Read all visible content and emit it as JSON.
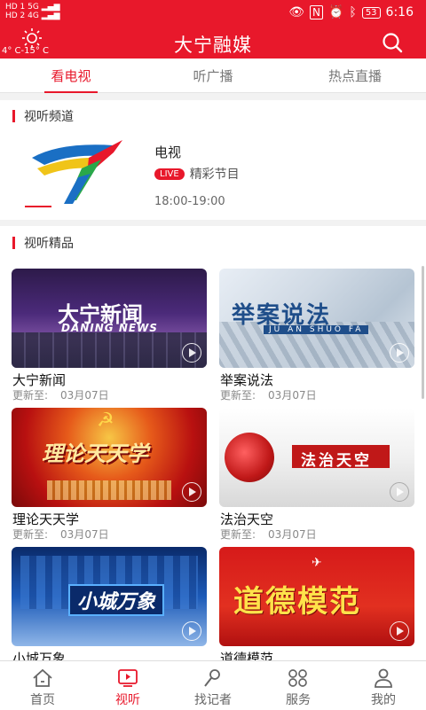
{
  "status_bar": {
    "sim1": "HD 1",
    "sim2": "HD 2",
    "network": "5G",
    "network2": "4G",
    "battery": "53",
    "time": "6:16"
  },
  "header": {
    "weather_temp": "4° C-15° C",
    "title": "大宁融媒",
    "weather_icon": "sun-icon",
    "search_icon": "search-icon"
  },
  "tabs": [
    {
      "label": "看电视"
    },
    {
      "label": "听广播"
    },
    {
      "label": "热点直播"
    }
  ],
  "channels_section": {
    "title": "视听频道"
  },
  "channel": {
    "name": "电视",
    "live_badge": "LIVE",
    "program": "精彩节目",
    "time": "18:00-19:00"
  },
  "premium_section": {
    "title": "视听精品"
  },
  "programs": [
    {
      "title": "大宁新闻",
      "update_label": "更新至:",
      "date": "03月07日",
      "thumb_text": "大宁新闻",
      "thumb_sub": "DANING NEWS"
    },
    {
      "title": "举案说法",
      "update_label": "更新至:",
      "date": "03月07日",
      "thumb_text": "举案说法",
      "thumb_sub": "JU AN SHUO FA"
    },
    {
      "title": "理论天天学",
      "update_label": "更新至:",
      "date": "03月07日",
      "thumb_text": "理论天天学"
    },
    {
      "title": "法治天空",
      "update_label": "更新至:",
      "date": "03月07日",
      "thumb_text": "法治天空"
    },
    {
      "title": "小城万象",
      "thumb_text": "小城万象"
    },
    {
      "title": "道德模范",
      "thumb_text": "道德模范"
    }
  ],
  "bottom_nav": [
    {
      "label": "首页",
      "icon": "home-icon"
    },
    {
      "label": "视听",
      "icon": "play-icon"
    },
    {
      "label": "找记者",
      "icon": "microphone-icon"
    },
    {
      "label": "服务",
      "icon": "grid-icon"
    },
    {
      "label": "我的",
      "icon": "user-icon"
    }
  ],
  "colors": {
    "brand_red": "#e8182b"
  }
}
